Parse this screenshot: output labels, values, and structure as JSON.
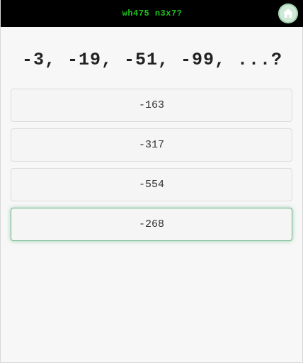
{
  "header": {
    "title": "wh475 n3x7?",
    "home_icon": "home-icon"
  },
  "question": {
    "text": "-3, -19, -51, -99, ...?"
  },
  "answers": [
    {
      "label": "-163",
      "selected": false
    },
    {
      "label": "-317",
      "selected": false
    },
    {
      "label": "-554",
      "selected": false
    },
    {
      "label": "-268",
      "selected": true
    }
  ],
  "colors": {
    "header_bg": "#000000",
    "title_text": "#1fc21f",
    "selected_border": "#6fb98a",
    "home_button_bg": "#cfe9d6"
  }
}
